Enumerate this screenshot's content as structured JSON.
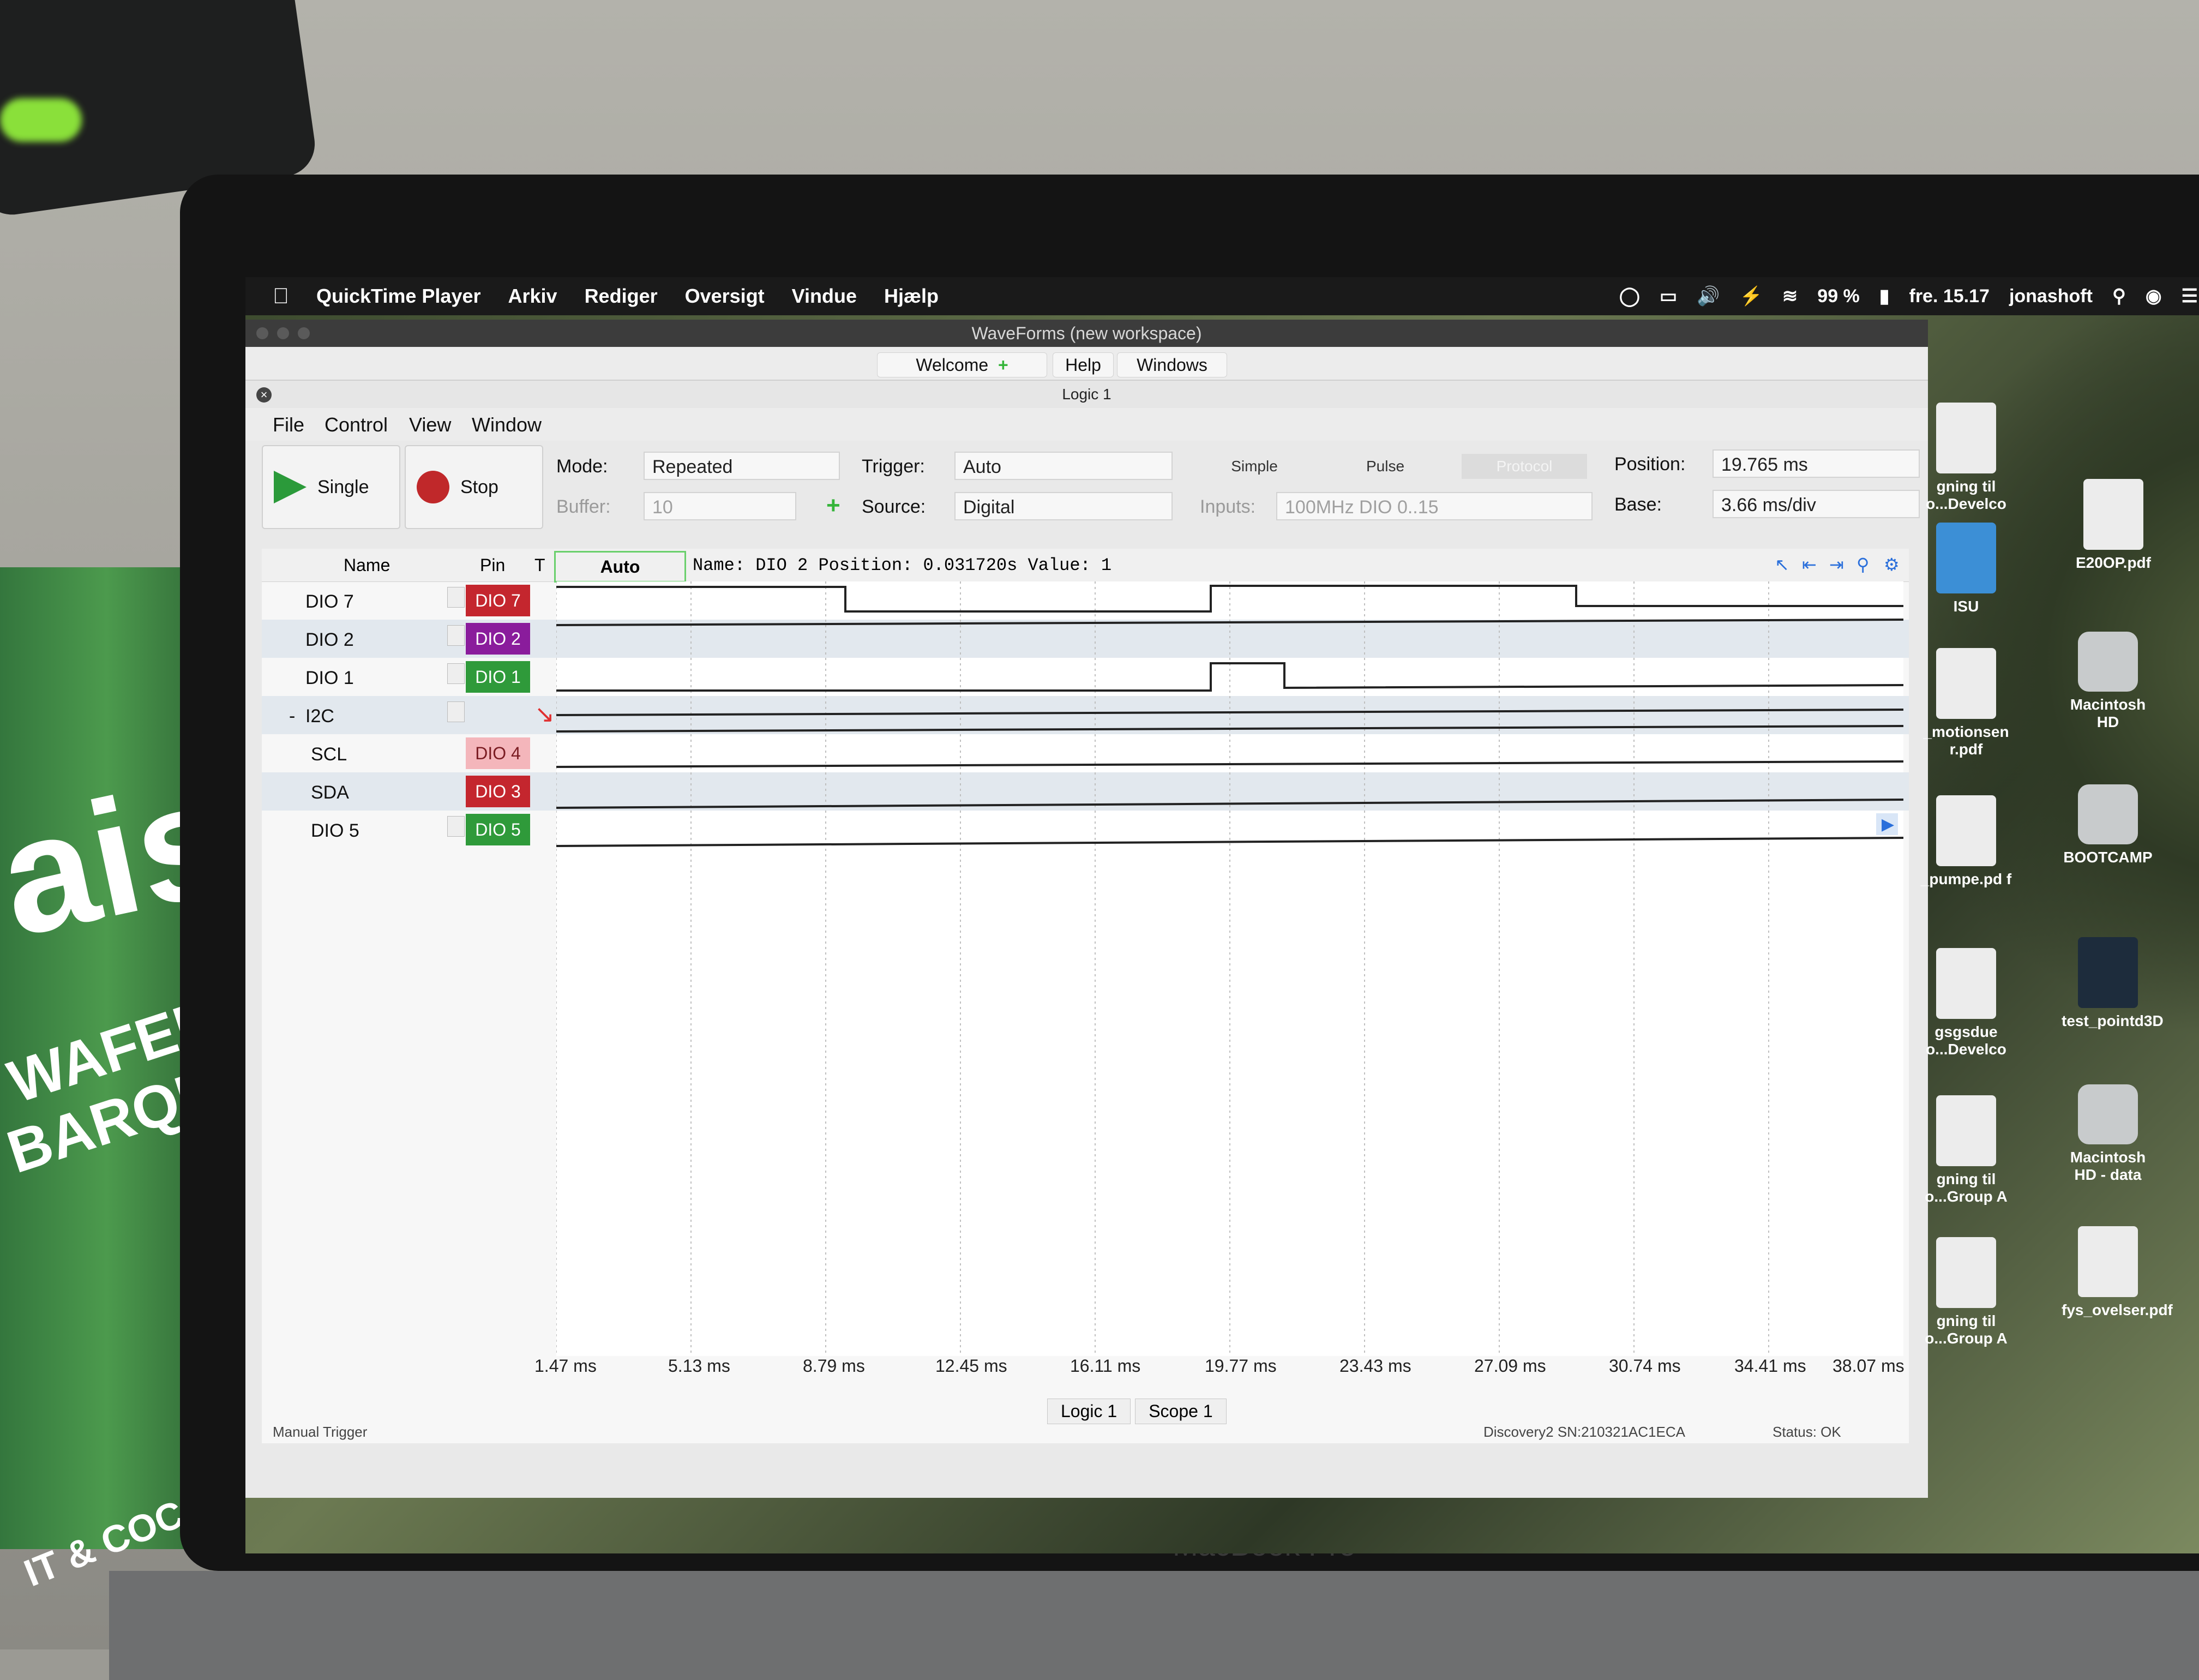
{
  "menubar": {
    "app": "QuickTime Player",
    "items": [
      "Arkiv",
      "Rediger",
      "Oversigt",
      "Vindue",
      "Hjælp"
    ],
    "battery": "99 %",
    "clock": "fre. 15.17",
    "user": "jonashoft"
  },
  "window": {
    "title": "WaveForms (new workspace)",
    "tabs": {
      "welcome": "Welcome",
      "help": "Help",
      "windows": "Windows"
    },
    "subtitle": "Logic 1",
    "menu": [
      "File",
      "Control",
      "View",
      "Window"
    ]
  },
  "toolbar": {
    "single": "Single",
    "stop": "Stop",
    "mode_label": "Mode:",
    "mode_value": "Repeated",
    "buffer_label": "Buffer:",
    "buffer_value": "10",
    "trigger_label": "Trigger:",
    "trigger_value": "Auto",
    "source_label": "Source:",
    "source_value": "Digital",
    "inputs_label": "Inputs:",
    "inputs_value": "100MHz DIO 0..15",
    "simple": "Simple",
    "pulse": "Pulse",
    "protocol": "Protocol",
    "position_label": "Position:",
    "position_value": "19.765 ms",
    "base_label": "Base:",
    "base_value": "3.66 ms/div"
  },
  "grid_header": {
    "name": "Name",
    "pin": "Pin",
    "t": "T",
    "auto": "Auto",
    "info": "Name: DIO 2  Position: 0.031720s  Value: 1"
  },
  "channels": [
    {
      "name": "DIO 7",
      "pin": "DIO 7",
      "color": "#c4262e"
    },
    {
      "name": "DIO 2",
      "pin": "DIO 2",
      "color": "#8a1c9c"
    },
    {
      "name": "DIO 1",
      "pin": "DIO 1",
      "color": "#2f9a3a"
    },
    {
      "name": "I2C",
      "pin": "",
      "color": ""
    },
    {
      "name": "SCL",
      "pin": "DIO 4",
      "color": "#f4b6bb"
    },
    {
      "name": "SDA",
      "pin": "DIO 3",
      "color": "#c4262e"
    },
    {
      "name": "DIO 5",
      "pin": "DIO 5",
      "color": "#2f9a3a"
    }
  ],
  "time_ticks": [
    "1.47 ms",
    "5.13 ms",
    "8.79 ms",
    "12.45 ms",
    "16.11 ms",
    "19.77 ms",
    "23.43 ms",
    "27.09 ms",
    "30.74 ms",
    "34.41 ms",
    "38.07 ms"
  ],
  "bottom_tabs": [
    "Logic 1",
    "Scope 1"
  ],
  "status": {
    "device": "Discovery2 SN:210321AC1ECA",
    "state": "Status: OK",
    "manual": "Manual Trigger"
  },
  "desktop_icons": [
    "gning til\n o...Develco",
    "E20OP.pdf",
    "ISU",
    "_motionsen r.pdf",
    "Macintosh HD",
    "_pumpe.pd f",
    "BOOTCAMP",
    "gsgsdue o...Develco",
    "test_pointd3D",
    "gning til o...Group A",
    "Macintosh HD - data",
    "gning til o...Group A",
    "fys_ovelser.pdf"
  ],
  "photo": {
    "can_brand": "aisti",
    "can_line1": "WAFER ROLLS",
    "can_line2": "BARQUILLOS",
    "can_line3": "IT & COCOA CREAM / Y PASTA DE CAC",
    "laptop_model": "MacBook Pro"
  }
}
